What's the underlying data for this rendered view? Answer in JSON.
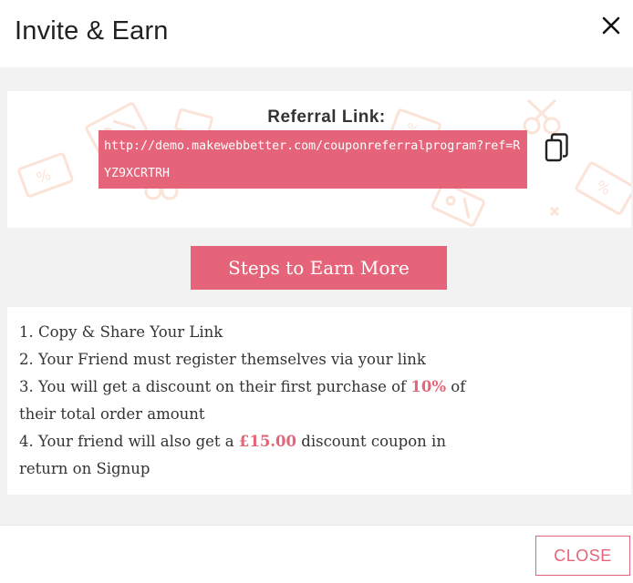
{
  "modal": {
    "title": "Invite & Earn"
  },
  "referral": {
    "label": "Referral Link:",
    "link": "http://demo.makewebbetter.com/couponreferralprogram?ref=RYZ9XCRTRH"
  },
  "steps_button": {
    "label": "Steps to Earn More"
  },
  "steps": {
    "step1": "1. Copy & Share Your Link",
    "step2": "2. Your Friend must register themselves via your link",
    "step3_prefix": "3. You will get a discount on their first purchase of ",
    "step3_highlight": "10%",
    "step3_suffix": " of their total order amount",
    "step4_prefix": "4. Your friend will also get a ",
    "step4_highlight": "£15.00",
    "step4_suffix": " discount coupon in return on Signup"
  },
  "footer": {
    "close_label": "CLOSE"
  },
  "icons": {
    "close": "close-icon",
    "copy": "copy-icon"
  },
  "colors": {
    "accent": "#e5647a",
    "body_bg": "#f2f2f2",
    "decor": "#fbe3d8"
  }
}
